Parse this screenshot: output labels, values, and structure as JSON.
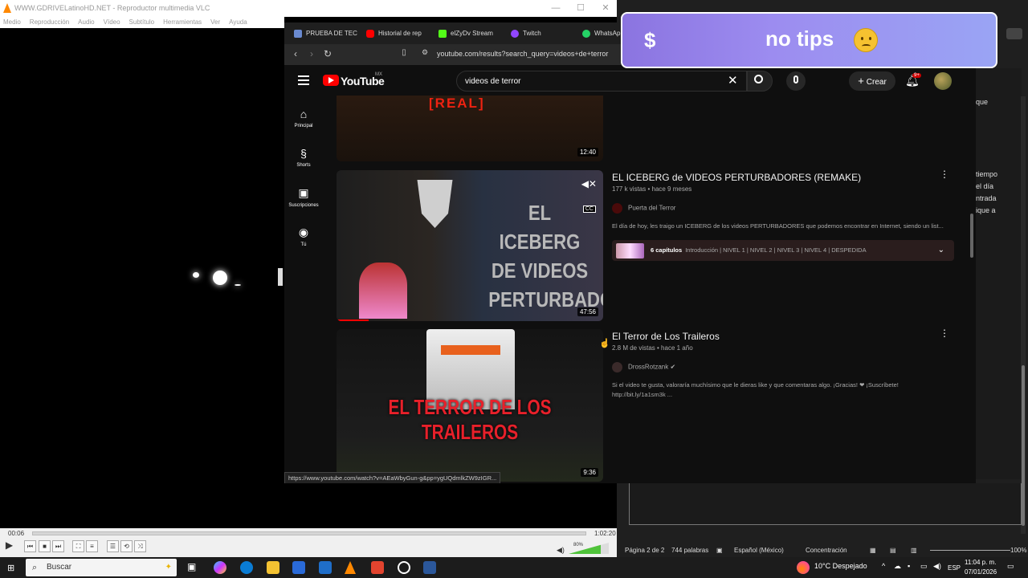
{
  "vlc": {
    "title": "WWW.GDRIVELatinoHD.NET - Reproductor multimedia VLC",
    "menu": [
      "Medio",
      "Reproducción",
      "Audio",
      "Vídeo",
      "Subtítulo",
      "Herramientas",
      "Ver",
      "Ayuda"
    ],
    "time_elapsed": "00:06",
    "time_total": "1:02:20",
    "volume": "80%",
    "progress": 0.002
  },
  "browser": {
    "tabs": [
      "PRUEBA DE TEC",
      "Historial de rep",
      "elZyDv Stream",
      "Twitch",
      "WhatsAp"
    ],
    "url": "youtube.com/results?search_query=videos+de+terror",
    "status_url": "https://www.youtube.com/watch?v=AEaWbyGun-g&pp=ygUQdmlkZW9zIGR..."
  },
  "youtube": {
    "logo": "YouTube",
    "region": "MX",
    "search_value": "videos de terror",
    "create_label": "Crear",
    "notif_badge": "9+",
    "sidebar": [
      {
        "label": "Principal",
        "icon": "home-icon"
      },
      {
        "label": "Shorts",
        "icon": "shorts-icon"
      },
      {
        "label": "Suscripciones",
        "icon": "subscriptions-icon"
      },
      {
        "label": "Tú",
        "icon": "you-icon"
      }
    ],
    "results": [
      {
        "thumb_text": "[REAL]",
        "duration": "12:40"
      },
      {
        "title": "EL ICEBERG de VIDEOS PERTURBADORES (REMAKE)",
        "meta": "177 k vistas • hace 9 meses",
        "channel": "Puerta del Terror",
        "description": "El día de hoy, les traigo un ICEBERG de los videos PERTURBADORES que podemos encontrar en Internet, siendo un list...",
        "chapters_count": "6 capítulos",
        "chapters": "Introducción | NIVEL 1 | NIVEL 2 | NIVEL 3 | NIVEL 4 | DESPEDIDA",
        "duration": "47:56",
        "thumb_text": "EL ICEBERG DE VIDEOS PERTURBADORES"
      },
      {
        "title": "El Terror de Los Traileros",
        "meta": "2.8 M de vistas • hace 1 año",
        "channel": "DrossRotzank",
        "description": "Si el video te gusta, valoraría muchísimo que le dieras like y que comentaras algo. ¡Gracias! ❤ ¡Suscríbete! http://bit.ly/1a1sm3k ...",
        "duration": "9:36",
        "thumb_text": "EL TERROR DE LOS TRAILEROS"
      }
    ]
  },
  "banner": {
    "symbol": "$",
    "text": "no tips"
  },
  "word": {
    "doc_lines": [
      "que",
      "",
      "",
      "",
      "",
      "",
      "tiempo",
      "el día",
      "ntrada",
      "ique a"
    ],
    "page": "Página 2 de 2",
    "words": "744 palabras",
    "lang": "Español (México)",
    "focus": "Concentración",
    "zoom": "100%"
  },
  "taskbar": {
    "search": "Buscar",
    "weather": "10°C  Despejado",
    "lang": "ESP",
    "time": "11:04 p. m.",
    "date": "07/01/2026"
  }
}
